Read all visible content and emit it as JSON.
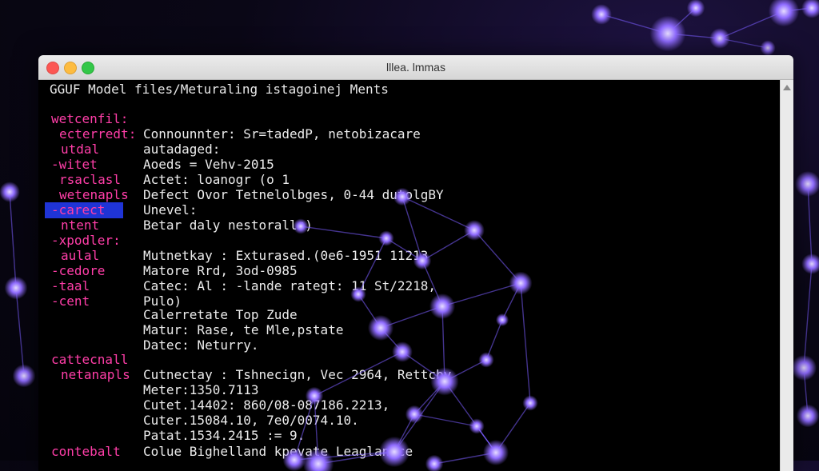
{
  "window": {
    "title": "lllea. lmmas"
  },
  "terminal": {
    "header": "GGUF Model files/Meturaling istagoinej Ments",
    "selected_index": 6,
    "labels": [
      "wetcenfil:",
      "ecterredt:",
      "utdal",
      "-witet",
      "rsaclasl",
      "wetenapls",
      "-carect",
      "ntent",
      "-xpodler:",
      "aulal",
      "-cedore",
      "-taal",
      "-cent",
      "cattecnall",
      "netanapls",
      "contebalt"
    ],
    "values": [
      "Connounnter: Sr=tadedP, netobizacare",
      "autadaged:",
      "Aoeds = Vehv-2015",
      "Actet: loanogr (o 1",
      "Defect Ovor Tetnelolbges, 0-44 dutolgBY",
      "Unevel:",
      "Betar daly nestoralls)",
      "Mutnetkay : Exturased.(0e6-1951 11213",
      "Matore Rrd, 3od-0985",
      "Catec: Al : -lande rategt: 11 St/2218,",
      "Pulo)",
      "Calerretate Top Zude",
      "Matur: Rase, te Mle,pstate",
      "Datec: Neturry.",
      "Cutnectay : Tshnecign, Vec 2964, Rettcby",
      "Meter:1350.7113",
      "Cutet.14402: 860/08-087186.2213,",
      "Cuter.15084.10, 7e0/0074.10.",
      "Patat.1534.2415 := 9.",
      "Colue Bighelland kpevate Leaglanice"
    ]
  },
  "colors": {
    "label": "#ff3ea8",
    "text": "#ececec",
    "selection": "#1f34d6",
    "node": "#8f6bff"
  }
}
